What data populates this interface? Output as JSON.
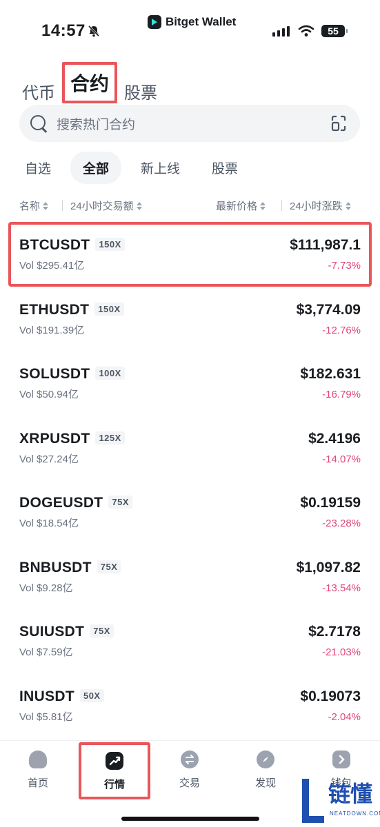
{
  "status_bar": {
    "time": "14:57",
    "brand": "Bitget Wallet",
    "battery": "55"
  },
  "top_tabs": [
    {
      "label": "代币",
      "active": false
    },
    {
      "label": "合约",
      "active": true
    },
    {
      "label": "股票",
      "active": false
    }
  ],
  "search": {
    "placeholder": "搜索热门合约"
  },
  "filter_chips": [
    {
      "label": "自选",
      "active": false
    },
    {
      "label": "全部",
      "active": true
    },
    {
      "label": "新上线",
      "active": false
    },
    {
      "label": "股票",
      "active": false
    }
  ],
  "columns": {
    "name": "名称",
    "volume": "24小时交易额",
    "price": "最新价格",
    "change": "24小时涨跌"
  },
  "rows": [
    {
      "symbol": "BTCUSDT",
      "leverage": "150X",
      "volume": "Vol $295.41亿",
      "price": "$111,987.1",
      "change": "-7.73%"
    },
    {
      "symbol": "ETHUSDT",
      "leverage": "150X",
      "volume": "Vol $191.39亿",
      "price": "$3,774.09",
      "change": "-12.76%"
    },
    {
      "symbol": "SOLUSDT",
      "leverage": "100X",
      "volume": "Vol $50.94亿",
      "price": "$182.631",
      "change": "-16.79%"
    },
    {
      "symbol": "XRPUSDT",
      "leverage": "125X",
      "volume": "Vol $27.24亿",
      "price": "$2.4196",
      "change": "-14.07%"
    },
    {
      "symbol": "DOGEUSDT",
      "leverage": "75X",
      "volume": "Vol $18.54亿",
      "price": "$0.19159",
      "change": "-23.28%"
    },
    {
      "symbol": "BNBUSDT",
      "leverage": "75X",
      "volume": "Vol $9.28亿",
      "price": "$1,097.82",
      "change": "-13.54%"
    },
    {
      "symbol": "SUIUSDT",
      "leverage": "75X",
      "volume": "Vol $7.59亿",
      "price": "$2.7178",
      "change": "-21.03%"
    },
    {
      "symbol": "INUSDT",
      "leverage": "50X",
      "volume": "Vol $5.81亿",
      "price": "$0.19073",
      "change": "-2.04%"
    }
  ],
  "bottom_nav": [
    {
      "label": "首页",
      "icon": "home-icon",
      "active": false
    },
    {
      "label": "行情",
      "icon": "market-chart-icon",
      "active": true
    },
    {
      "label": "交易",
      "icon": "swap-icon",
      "active": false
    },
    {
      "label": "发现",
      "icon": "compass-icon",
      "active": false
    },
    {
      "label": "钱包",
      "icon": "wallet-icon",
      "active": false
    }
  ],
  "watermark": {
    "text": "链懂",
    "sub": "NEATDOWN.COM"
  },
  "colors": {
    "negative": "#e0467c",
    "highlight_box": "#e8565a",
    "brand_accent": "#2ee6d6"
  }
}
